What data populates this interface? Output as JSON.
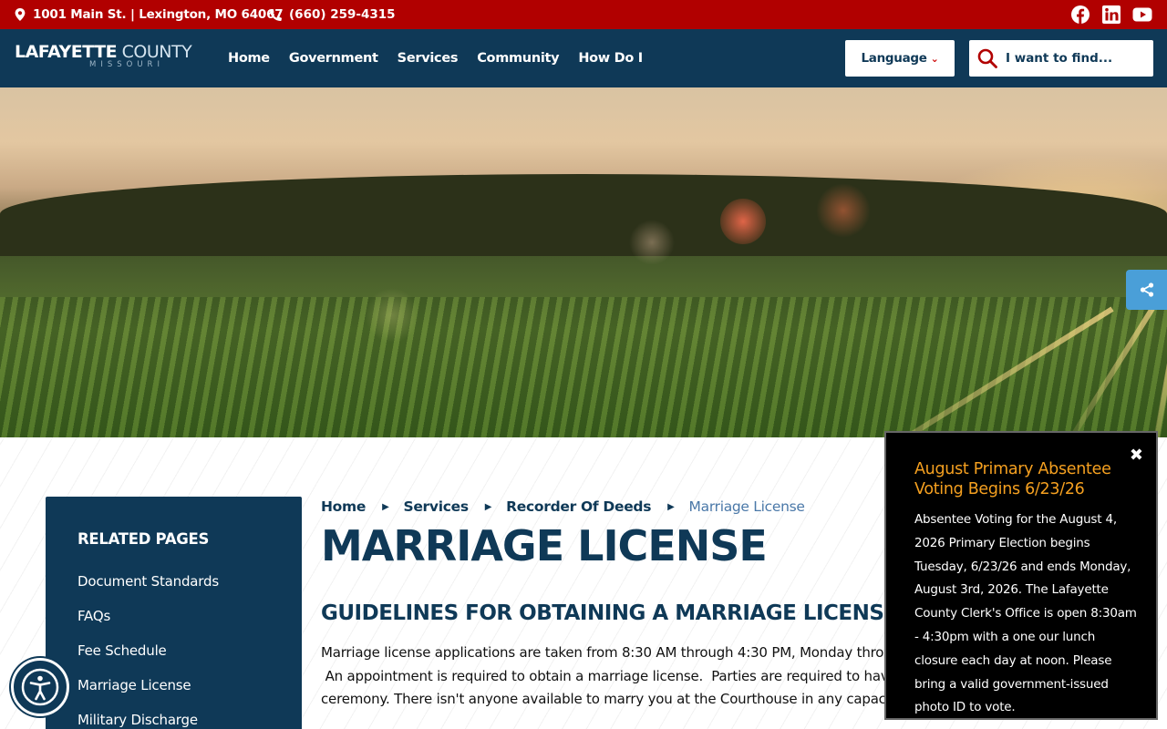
{
  "topbar": {
    "address": "1001 Main St. | Lexington, MO 64067",
    "phone": "(660) 259-4315",
    "social": [
      {
        "name": "facebook-icon"
      },
      {
        "name": "linkedin-icon"
      },
      {
        "name": "youtube-icon"
      }
    ],
    "background": "#b10000"
  },
  "nav": {
    "logo_main_bold": "LAFAYETTE",
    "logo_main_thin": " COUNTY",
    "logo_sub": "MISSOURI",
    "items": [
      {
        "label": "Home"
      },
      {
        "label": "Government"
      },
      {
        "label": "Services"
      },
      {
        "label": "Community"
      },
      {
        "label": "How Do I"
      }
    ],
    "language_label": "Language",
    "search_placeholder": "I want to find...",
    "background": "#0f3957"
  },
  "sidebar": {
    "title": "RELATED PAGES",
    "items": [
      {
        "label": "Document Standards"
      },
      {
        "label": "FAQs"
      },
      {
        "label": "Fee Schedule"
      },
      {
        "label": "Marriage License"
      },
      {
        "label": "Military Discharge"
      }
    ]
  },
  "breadcrumb": {
    "items": [
      {
        "label": "Home"
      },
      {
        "label": "Services"
      },
      {
        "label": "Recorder Of Deeds"
      }
    ],
    "current": "Marriage License"
  },
  "main": {
    "title": "MARRIAGE LICENSE",
    "subtitle": "GUIDELINES FOR OBTAINING A MARRIAGE LICENSE",
    "paragraph_lines": [
      "Marriage license applications are taken from 8:30 AM through 4:30 PM, Monday thro",
      " An appointment is required to obtain a marriage license.  Parties are required to hav",
      "ceremony. There isn't anyone available to marry you at the Courthouse in any capac"
    ]
  },
  "alert": {
    "title": "August Primary Absentee Voting Begins 6/23/26",
    "body": "Absentee Voting for the August 4, 2026 Primary Election begins Tuesday, 6/23/26 and ends Monday, August 3rd, 2026. The Lafayette County Clerk's Office is open 8:30am - 4:30pm with a one our lunch closure each day at noon. Please bring a valid government-issued photo ID to vote.",
    "title_color": "#f5a020"
  },
  "colors": {
    "accent_red": "#b10000",
    "navy": "#0f3957",
    "share_blue": "#4a9fd8"
  }
}
